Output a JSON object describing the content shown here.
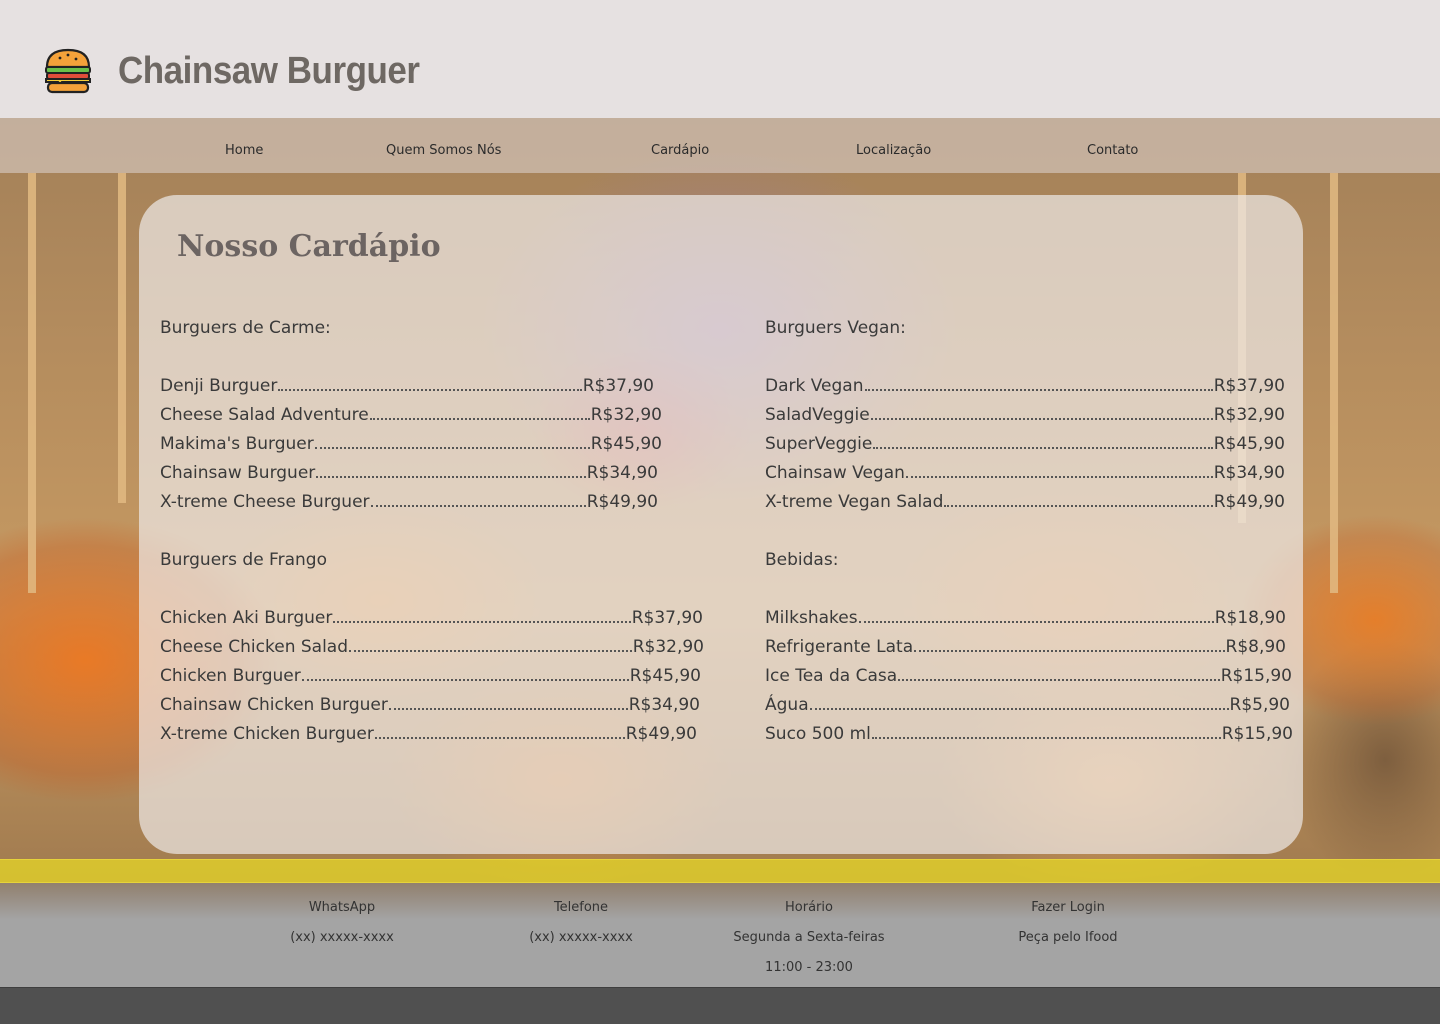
{
  "brand": {
    "logo_icon": "burger-icon",
    "name": "Chainsaw Burguer"
  },
  "nav": {
    "items": [
      {
        "label": "Home"
      },
      {
        "label": "Quem Somos Nós"
      },
      {
        "label": "Cardápio"
      },
      {
        "label": "Localização"
      },
      {
        "label": "Contato"
      }
    ]
  },
  "menu": {
    "title": "Nosso Cardápio",
    "sections": [
      {
        "title": "Burguers de Carme:",
        "items": [
          {
            "name": "Denji Burguer",
            "price": "R$37,90"
          },
          {
            "name": "Cheese Salad Adventure",
            "price": "R$32,90"
          },
          {
            "name": "Makima's Burguer",
            "price": "R$45,90"
          },
          {
            "name": "Chainsaw Burguer",
            "price": "R$34,90"
          },
          {
            "name": "X-treme Cheese Burguer",
            "price": "R$49,90"
          }
        ]
      },
      {
        "title": "Burguers Vegan:",
        "items": [
          {
            "name": "Dark Vegan",
            "price": "R$37,90"
          },
          {
            "name": "SaladVeggie",
            "price": "R$32,90"
          },
          {
            "name": "SuperVeggie",
            "price": "R$45,90"
          },
          {
            "name": "Chainsaw Vegan",
            "price": "R$34,90"
          },
          {
            "name": "X-treme Vegan Salad",
            "price": "R$49,90"
          }
        ]
      },
      {
        "title": "Burguers de Frango",
        "items": [
          {
            "name": "Chicken Aki Burguer",
            "price": "R$37,90"
          },
          {
            "name": "Cheese Chicken Salad",
            "price": "R$32,90"
          },
          {
            "name": "Chicken Burguer",
            "price": "R$45,90"
          },
          {
            "name": "Chainsaw Chicken Burguer",
            "price": "R$34,90"
          },
          {
            "name": "X-treme Chicken Burguer",
            "price": "R$49,90"
          }
        ]
      },
      {
        "title": "Bebidas:",
        "items": [
          {
            "name": "Milkshakes",
            "price": "R$18,90"
          },
          {
            "name": "Refrigerante Lata",
            "price": "R$8,90"
          },
          {
            "name": "Ice Tea da Casa",
            "price": "R$15,90"
          },
          {
            "name": "Água",
            "price": "R$5,90"
          },
          {
            "name": "Suco 500 ml",
            "price": "R$15,90"
          }
        ]
      }
    ]
  },
  "footer": {
    "columns": [
      {
        "title": "WhatsApp",
        "lines": [
          "(xx) xxxxx-xxxx"
        ]
      },
      {
        "title": "Telefone",
        "lines": [
          "(xx) xxxxx-xxxx"
        ]
      },
      {
        "title": "Horário",
        "lines": [
          "Segunda a Sexta-feiras",
          "11:00 - 23:00"
        ]
      },
      {
        "title": "Fazer Login",
        "lines": [
          "Peça pelo Ifood"
        ]
      }
    ]
  },
  "colors": {
    "header_bg": "#e6e1e1",
    "brand_text": "#6e6863",
    "accent_yellow": "#e2d228",
    "footer_bg": "#a4a4a4",
    "bottom_bar": "#505050"
  }
}
